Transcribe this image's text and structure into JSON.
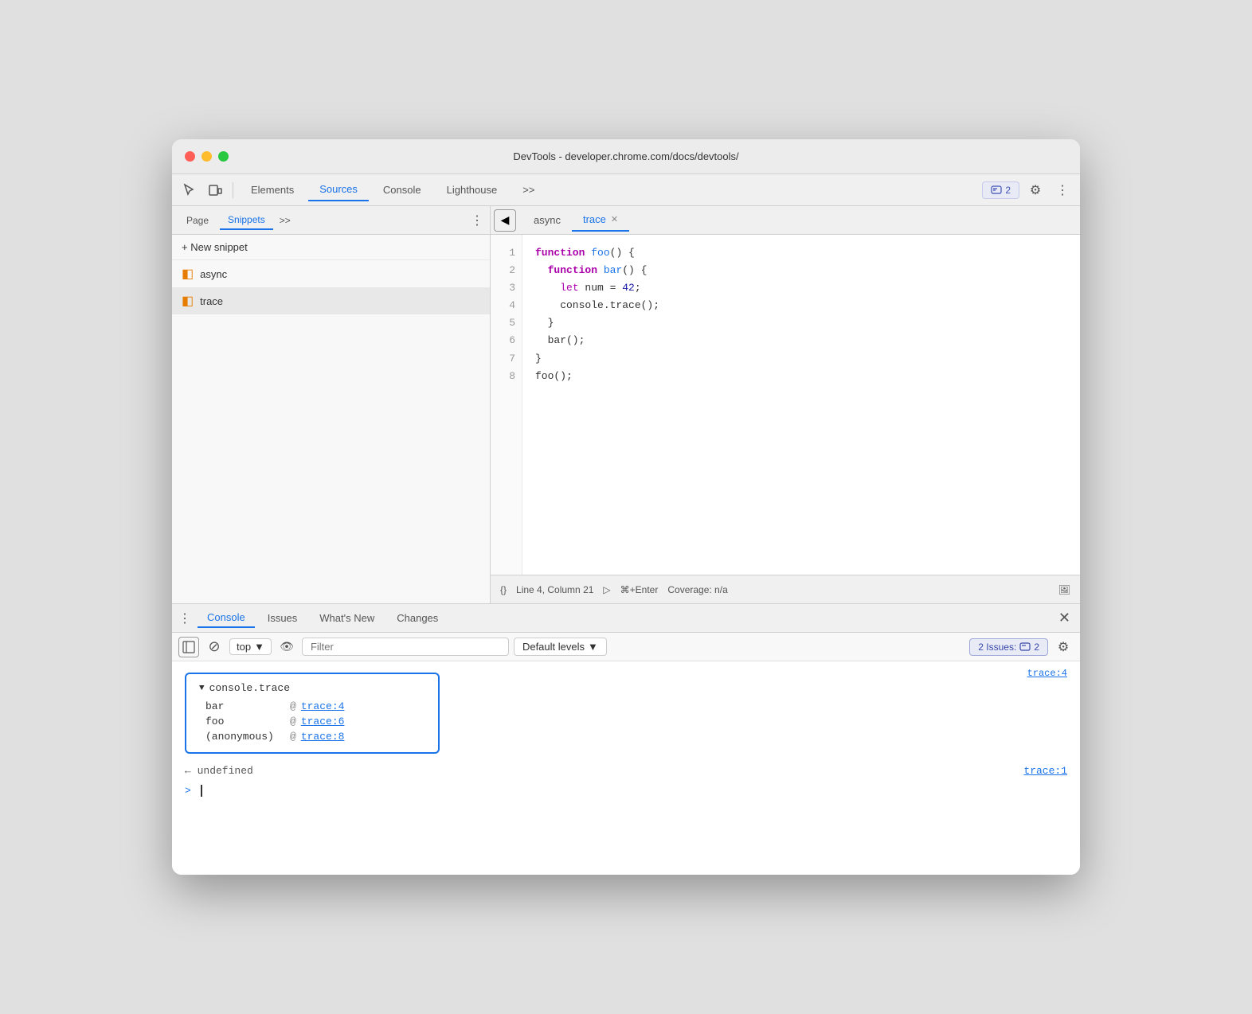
{
  "window": {
    "title": "DevTools - developer.chrome.com/docs/devtools/"
  },
  "toolbar": {
    "tabs": [
      {
        "id": "elements",
        "label": "Elements",
        "active": false
      },
      {
        "id": "sources",
        "label": "Sources",
        "active": true
      },
      {
        "id": "console",
        "label": "Console",
        "active": false
      },
      {
        "id": "lighthouse",
        "label": "Lighthouse",
        "active": false
      },
      {
        "id": "more",
        "label": ">>",
        "active": false
      }
    ],
    "badge_label": "2",
    "settings_label": "⚙"
  },
  "sidebar": {
    "tabs": [
      {
        "id": "page",
        "label": "Page",
        "active": false
      },
      {
        "id": "snippets",
        "label": "Snippets",
        "active": true
      }
    ],
    "more_label": ">>",
    "new_snippet_label": "+ New snippet",
    "snippets": [
      {
        "id": "async",
        "label": "async",
        "active": false
      },
      {
        "id": "trace",
        "label": "trace",
        "active": true
      }
    ]
  },
  "editor": {
    "sidebar_toggle": "◀",
    "tabs": [
      {
        "id": "async",
        "label": "async",
        "active": false,
        "closeable": false
      },
      {
        "id": "trace",
        "label": "trace",
        "active": true,
        "closeable": true
      }
    ],
    "code": {
      "lines": [
        {
          "num": 1,
          "text": "function foo() {"
        },
        {
          "num": 2,
          "text": "  function bar() {"
        },
        {
          "num": 3,
          "text": "    let num = 42;"
        },
        {
          "num": 4,
          "text": "    console.trace();"
        },
        {
          "num": 5,
          "text": "  }"
        },
        {
          "num": 6,
          "text": "  bar();"
        },
        {
          "num": 7,
          "text": "}"
        },
        {
          "num": 8,
          "text": "foo();"
        }
      ]
    }
  },
  "status_bar": {
    "curly_icon": "{}",
    "position": "Line 4, Column 21",
    "run_icon": "▷",
    "shortcut": "⌘+Enter",
    "coverage": "Coverage: n/a"
  },
  "console_panel": {
    "tabs": [
      {
        "id": "console",
        "label": "Console",
        "active": true
      },
      {
        "id": "issues",
        "label": "Issues",
        "active": false
      },
      {
        "id": "whats_new",
        "label": "What's New",
        "active": false
      },
      {
        "id": "changes",
        "label": "Changes",
        "active": false
      }
    ],
    "toolbar": {
      "sidebar_icon": "⊞",
      "clear_icon": "⊘",
      "top_label": "top",
      "dropdown_arrow": "▼",
      "eye_icon": "👁",
      "filter_placeholder": "Filter",
      "levels_label": "Default levels",
      "levels_arrow": "▼",
      "issues_label": "2 Issues:",
      "issues_badge": "2",
      "settings_icon": "⚙"
    },
    "output": {
      "trace_header": "console.trace",
      "trace_location": "trace:4",
      "trace_rows": [
        {
          "fn": "bar",
          "at": "@",
          "link": "trace:4"
        },
        {
          "fn": "foo",
          "at": "@",
          "link": "trace:6"
        },
        {
          "fn": "(anonymous)",
          "at": "@",
          "link": "trace:8"
        }
      ],
      "undefined_text": "← undefined",
      "undefined_loc": "trace:1",
      "prompt": ">"
    }
  }
}
